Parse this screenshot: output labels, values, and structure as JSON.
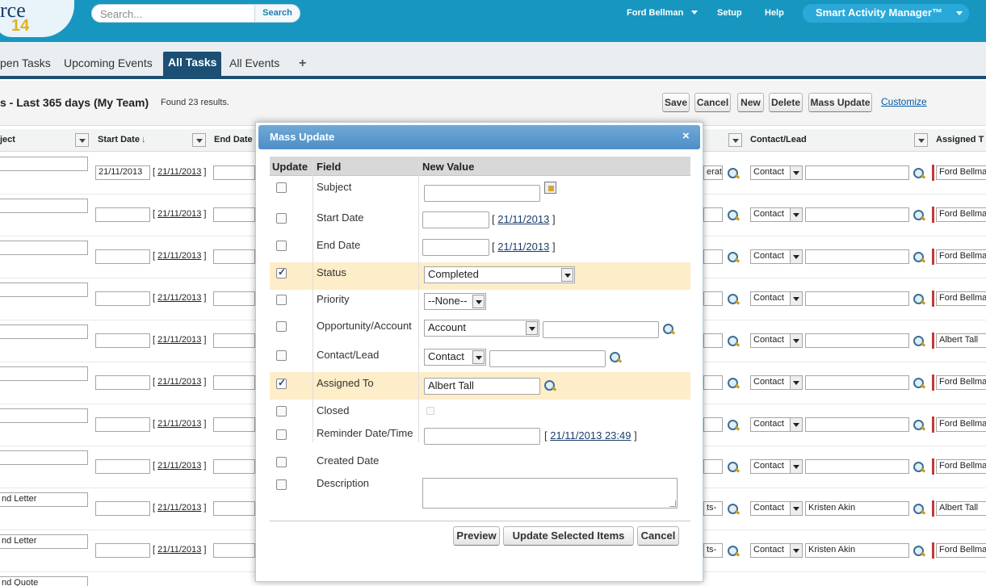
{
  "header": {
    "logo_text": "rce",
    "logo_num": "14",
    "search_placeholder": "Search...",
    "search_button": "Search",
    "user": "Ford Bellman",
    "setup": "Setup",
    "help": "Help",
    "app_menu": "Smart Activity Manager™"
  },
  "tabs": [
    {
      "label": "pen Tasks"
    },
    {
      "label": "Upcoming Events"
    },
    {
      "label": "All Tasks"
    },
    {
      "label": "All Events"
    },
    {
      "label": "+"
    }
  ],
  "page": {
    "title": "s - Last 365 days (My Team)",
    "found": "Found 23 results.",
    "buttons": {
      "save": "Save",
      "cancel": "Cancel",
      "new": "New",
      "delete": "Delete",
      "mass_update": "Mass Update"
    },
    "customize": "Customize"
  },
  "columns": {
    "subject": "ject",
    "start_date": "Start Date",
    "sort_arrow": "↓",
    "end_date": "End Date",
    "contact_lead": "Contact/Lead",
    "assigned": "Assigned T"
  },
  "rows": [
    {
      "subject": "",
      "start": "21/11/2013",
      "start_link": "21/11/2013",
      "opp": "erat",
      "contact_type": "Contact",
      "contact": "",
      "assigned": "Ford Bellman"
    },
    {
      "subject": "",
      "start": "",
      "start_link": "21/11/2013",
      "opp": "",
      "contact_type": "Contact",
      "contact": "",
      "assigned": "Ford Bellman"
    },
    {
      "subject": "",
      "start": "",
      "start_link": "21/11/2013",
      "opp": "",
      "contact_type": "Contact",
      "contact": "",
      "assigned": "Ford Bellman"
    },
    {
      "subject": "",
      "start": "",
      "start_link": "21/11/2013",
      "opp": "",
      "contact_type": "Contact",
      "contact": "",
      "assigned": "Ford Bellman"
    },
    {
      "subject": "",
      "start": "",
      "start_link": "21/11/2013",
      "opp": "",
      "contact_type": "Contact",
      "contact": "",
      "assigned": "Albert Tall"
    },
    {
      "subject": "",
      "start": "",
      "start_link": "21/11/2013",
      "opp": "",
      "contact_type": "Contact",
      "contact": "",
      "assigned": "Ford Bellman"
    },
    {
      "subject": "",
      "start": "",
      "start_link": "21/11/2013",
      "opp": "",
      "contact_type": "Contact",
      "contact": "",
      "assigned": "Ford Bellman"
    },
    {
      "subject": "",
      "start": "",
      "start_link": "21/11/2013",
      "opp": "",
      "contact_type": "Contact",
      "contact": "",
      "assigned": "Ford Bellman"
    },
    {
      "subject": "nd Letter",
      "start": "",
      "start_link": "21/11/2013",
      "opp": "ts-",
      "contact_type": "Contact",
      "contact": "Kristen Akin",
      "assigned": "Albert Tall"
    },
    {
      "subject": "nd Letter",
      "start": "",
      "start_link": "21/11/2013",
      "opp": "ts-",
      "contact_type": "Contact",
      "contact": "Kristen Akin",
      "assigned": "Ford Bellman"
    },
    {
      "subject": "nd Quote",
      "start": "",
      "start_link": "",
      "opp": "",
      "contact_type": "",
      "contact": "",
      "assigned": ""
    }
  ],
  "dialog": {
    "title": "Mass Update",
    "close": "×",
    "col_update": "Update",
    "col_field": "Field",
    "col_value": "New Value",
    "fields": {
      "subject": {
        "label": "Subject",
        "checked": false,
        "value": ""
      },
      "start_date": {
        "label": "Start Date",
        "checked": false,
        "link": "21/11/2013"
      },
      "end_date": {
        "label": "End Date",
        "checked": false,
        "link": "21/11/2013"
      },
      "status": {
        "label": "Status",
        "checked": true,
        "value": "Completed"
      },
      "priority": {
        "label": "Priority",
        "checked": false,
        "value": "--None--"
      },
      "opportunity": {
        "label": "Opportunity/Account",
        "checked": false,
        "value": "Account"
      },
      "contact": {
        "label": "Contact/Lead",
        "checked": false,
        "value": "Contact"
      },
      "assigned": {
        "label": "Assigned To",
        "checked": true,
        "value": "Albert Tall"
      },
      "closed": {
        "label": "Closed",
        "checked": false
      },
      "reminder": {
        "label": "Reminder Date/Time",
        "checked": false,
        "link": "21/11/2013 23:49"
      },
      "created": {
        "label": "Created Date",
        "checked": false
      },
      "description": {
        "label": "Description",
        "checked": false
      }
    },
    "buttons": {
      "preview": "Preview",
      "update": "Update Selected Items",
      "cancel": "Cancel"
    }
  },
  "colors": {
    "topbar": "#1797c0",
    "tab_active": "#1b4f73",
    "highlight_row": "#fdedc8",
    "dialog_header": "#5a9acc",
    "owner_bar": "#c23934"
  }
}
